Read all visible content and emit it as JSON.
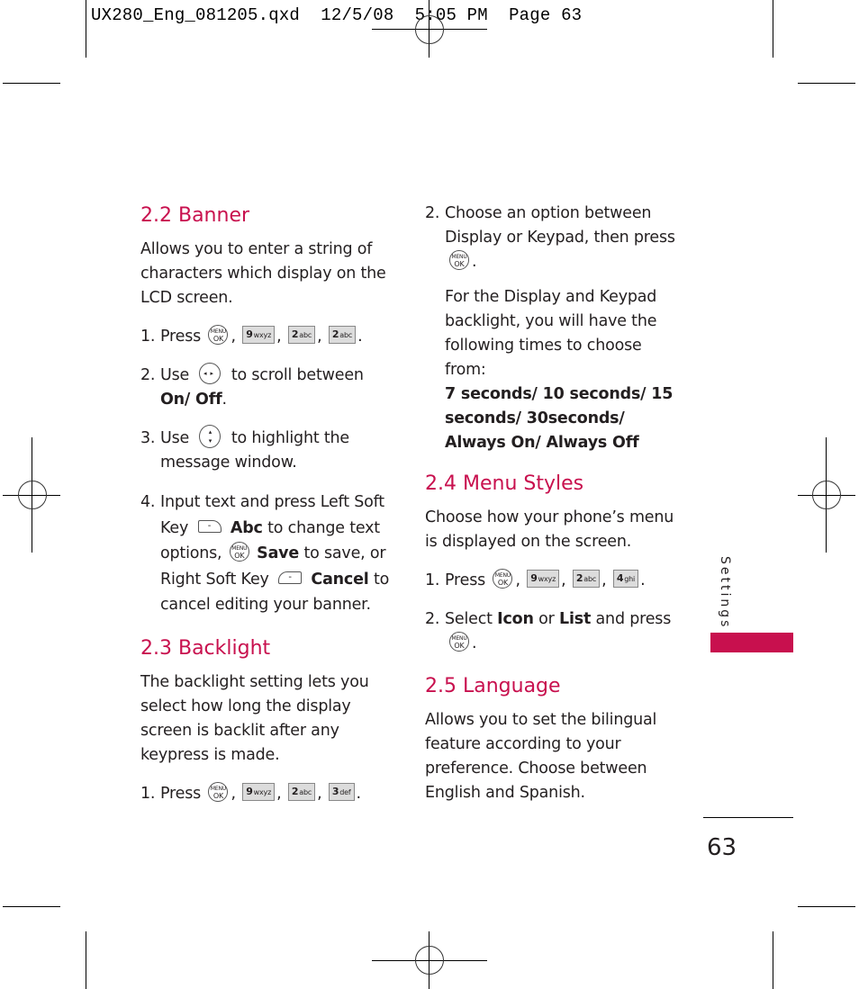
{
  "slug": "UX280_Eng_081205.qxd  12/5/08  5:05 PM  Page 63",
  "colors": {
    "accent": "#c8104e",
    "text": "#231f20"
  },
  "keys": {
    "ok_top": "MENU",
    "ok_bottom": "OK",
    "k9": {
      "digit": "9",
      "letters": "wxyz"
    },
    "k2": {
      "digit": "2",
      "letters": "abc"
    },
    "k3": {
      "digit": "3",
      "letters": "def"
    },
    "k4": {
      "digit": "4",
      "letters": "ghi"
    },
    "left_soft": "-",
    "right_soft": "-",
    "lr_nav": "◂▸",
    "ud_nav_up": "▴",
    "ud_nav_down": "▾"
  },
  "banner": {
    "heading": "2.2 Banner",
    "intro": "Allows you to enter a string of characters which display on the LCD screen.",
    "step1": {
      "num": "1.",
      "text": "Press",
      "sep": ",",
      "end": "."
    },
    "step2": {
      "num": "2.",
      "pre": "Use",
      "post": "to scroll between",
      "bold": "On/ Off",
      "end": "."
    },
    "step3": {
      "num": "3.",
      "pre": "Use",
      "post": "to highlight the message window."
    },
    "step4": {
      "num": "4.",
      "t1": "Input text and press Left Soft Key",
      "b1": "Abc",
      "t2": "to change text options,",
      "b2": "Save",
      "t3": "to save, or Right Soft Key",
      "b3": "Cancel",
      "t4": "to cancel editing your banner."
    }
  },
  "backlight": {
    "heading": "2.3 Backlight",
    "intro": "The backlight setting lets you select how long the display screen is backlit after any keypress is made.",
    "step1": {
      "num": "1.",
      "text": "Press",
      "sep": ",",
      "end": "."
    },
    "step2": {
      "num": "2.",
      "text": "Choose an option between Display or Keypad, then press",
      "end": "."
    },
    "note": "For the Display and Keypad backlight, you will have the following times to choose from:",
    "options": "7 seconds/ 10 seconds/ 15 seconds/ 30seconds/ Always On/ Always Off"
  },
  "menu_styles": {
    "heading": "2.4 Menu Styles",
    "intro": "Choose how your phone’s menu is displayed on the screen.",
    "step1": {
      "num": "1.",
      "text": "Press",
      "sep": ",",
      "end": "."
    },
    "step2": {
      "num": "2.",
      "pre": "Select",
      "b1": "Icon",
      "mid": "or",
      "b2": "List",
      "post": "and press",
      "end": "."
    }
  },
  "language": {
    "heading": "2.5 Language",
    "intro": "Allows you to set the bilingual feature according to your preference. Choose between English and Spanish."
  },
  "side_tab": {
    "label": "Settings"
  },
  "page_number": "63"
}
